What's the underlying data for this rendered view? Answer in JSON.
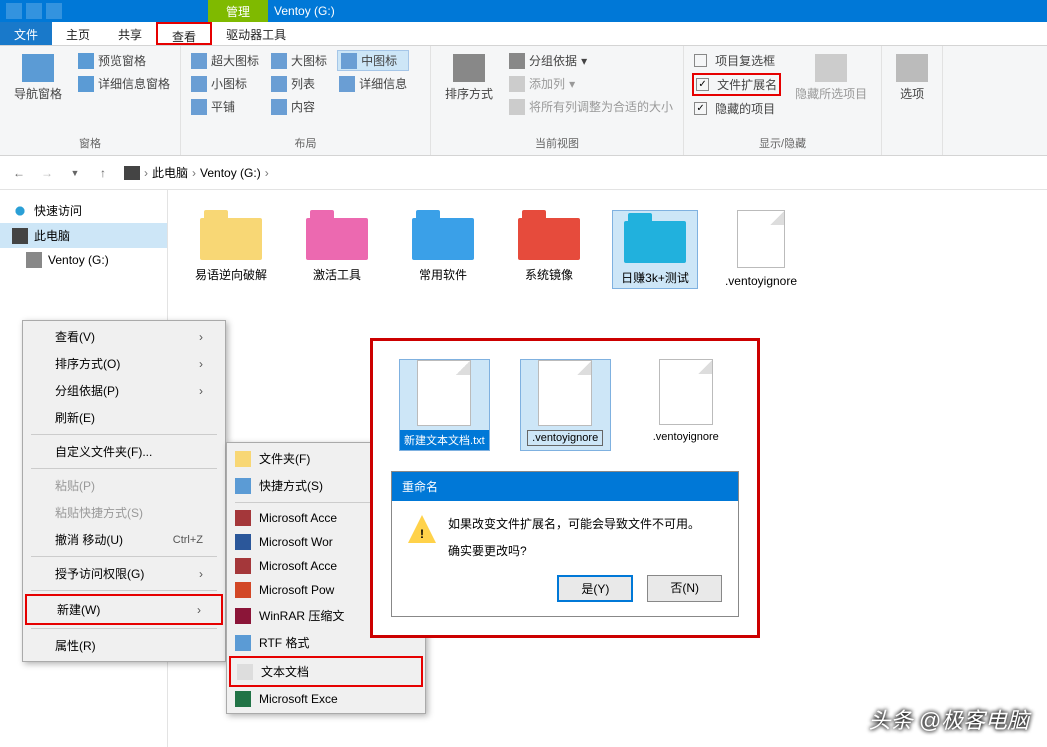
{
  "window": {
    "manage_tab": "管理",
    "title": "Ventoy (G:)"
  },
  "tabs": {
    "file": "文件",
    "home": "主页",
    "share": "共享",
    "view": "查看",
    "drive_tools": "驱动器工具"
  },
  "ribbon": {
    "panes": {
      "nav": "导航窗格",
      "preview": "预览窗格",
      "details": "详细信息窗格",
      "group_label": "窗格"
    },
    "layout": {
      "extra_large": "超大图标",
      "large": "大图标",
      "medium": "中图标",
      "small": "小图标",
      "list": "列表",
      "details": "详细信息",
      "tiles": "平铺",
      "content": "内容",
      "group_label": "布局"
    },
    "current_view": {
      "sort": "排序方式",
      "group_by": "分组依据",
      "add_columns": "添加列",
      "size_all": "将所有列调整为合适的大小",
      "group_label": "当前视图"
    },
    "show_hide": {
      "item_checkboxes": "项目复选框",
      "file_ext": "文件扩展名",
      "hidden_items": "隐藏的项目",
      "hide_selected": "隐藏所选项目",
      "group_label": "显示/隐藏"
    },
    "options": {
      "options": "选项"
    }
  },
  "breadcrumb": {
    "this_pc": "此电脑",
    "drive": "Ventoy (G:)"
  },
  "sidebar": {
    "quick_access": "快速访问",
    "this_pc": "此电脑",
    "drive": "Ventoy (G:)"
  },
  "files": {
    "items": [
      {
        "name": "易语逆向破解",
        "color": "yellow"
      },
      {
        "name": "激活工具",
        "color": "pink"
      },
      {
        "name": "常用软件",
        "color": "blue"
      },
      {
        "name": "系统镜像",
        "color": "red"
      },
      {
        "name": "日赚3k+测试",
        "color": "cyan",
        "selected": true
      },
      {
        "name": ".ventoyignore",
        "type": "file"
      }
    ]
  },
  "context_menu": {
    "view": "查看(V)",
    "sort": "排序方式(O)",
    "group": "分组依据(P)",
    "refresh": "刷新(E)",
    "customize": "自定义文件夹(F)...",
    "paste": "粘贴(P)",
    "paste_shortcut": "粘贴快捷方式(S)",
    "undo_move": "撤消 移动(U)",
    "undo_shortcut": "Ctrl+Z",
    "grant_access": "授予访问权限(G)",
    "new": "新建(W)",
    "properties": "属性(R)"
  },
  "new_submenu": {
    "folder": "文件夹(F)",
    "shortcut": "快捷方式(S)",
    "access": "Microsoft Acce",
    "word": "Microsoft Wor",
    "access2": "Microsoft Acce",
    "ppt": "Microsoft Pow",
    "winrar": "WinRAR 压缩文",
    "rtf": "RTF 格式",
    "text": "文本文档",
    "excel": "Microsoft Exce"
  },
  "overlay": {
    "file1": "新建文本文档.txt",
    "file2": ".ventoyignore",
    "file3": ".ventoyignore"
  },
  "dialog": {
    "title": "重命名",
    "line1": "如果改变文件扩展名，可能会导致文件不可用。",
    "line2": "确实要更改吗?",
    "yes": "是(Y)",
    "no": "否(N)"
  },
  "watermark": {
    "prefix": "头条",
    "text": "@极客电脑"
  }
}
